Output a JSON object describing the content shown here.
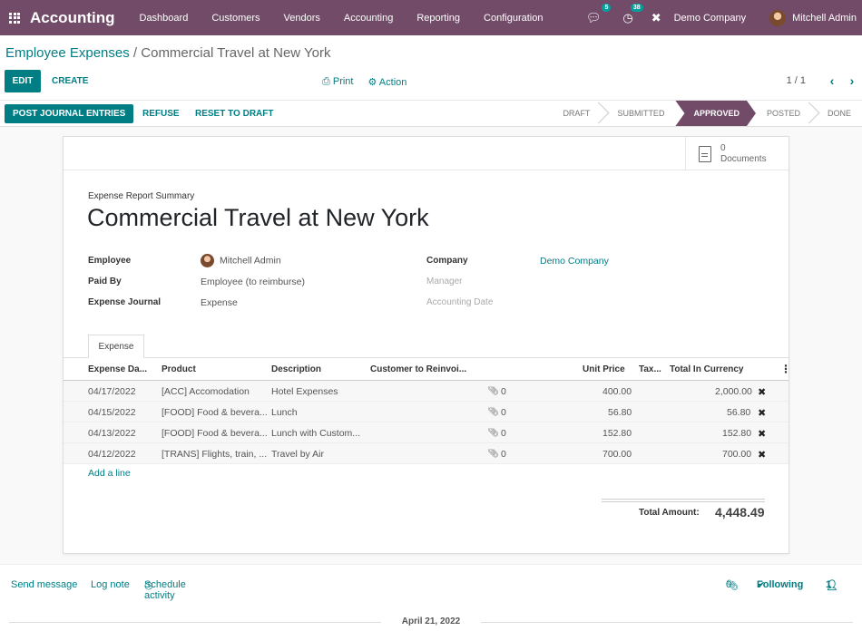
{
  "navbar": {
    "app_title": "Accounting",
    "menu": [
      "Dashboard",
      "Customers",
      "Vendors",
      "Accounting",
      "Reporting",
      "Configuration"
    ],
    "messages_count": "5",
    "activities_count": "38",
    "company": "Demo Company",
    "user": "Mitchell Admin"
  },
  "breadcrumb": {
    "parent": "Employee Expenses",
    "separator": "/",
    "current": "Commercial Travel at New York"
  },
  "controls": {
    "edit": "EDIT",
    "create": "CREATE",
    "print": "Print",
    "action": "Action",
    "pager": "1 / 1"
  },
  "statusbar": {
    "post": "POST JOURNAL ENTRIES",
    "refuse": "REFUSE",
    "reset": "RESET TO DRAFT",
    "stages": [
      "DRAFT",
      "SUBMITTED",
      "APPROVED",
      "POSTED",
      "DONE"
    ],
    "active_stage": "APPROVED"
  },
  "documents": {
    "count": "0",
    "label": "Documents"
  },
  "form": {
    "summary_label": "Expense Report Summary",
    "title": "Commercial Travel at New York",
    "employee_label": "Employee",
    "employee": "Mitchell Admin",
    "paid_by_label": "Paid By",
    "paid_by": "Employee (to reimburse)",
    "journal_label": "Expense Journal",
    "journal": "Expense",
    "company_label": "Company",
    "company": "Demo Company",
    "manager_label": "Manager",
    "accounting_date_label": "Accounting Date"
  },
  "tab": "Expense",
  "table": {
    "headers": [
      "Expense Da...",
      "Product",
      "Description",
      "Customer to Reinvoi...",
      "Unit Price",
      "Tax...",
      "Total In Currency"
    ],
    "rows": [
      {
        "date": "04/17/2022",
        "product": "[ACC] Accomodation",
        "description": "Hotel Expenses",
        "attachments": "0",
        "unit_price": "400.00",
        "total": "2,000.00"
      },
      {
        "date": "04/15/2022",
        "product": "[FOOD] Food & bevera...",
        "description": "Lunch",
        "attachments": "0",
        "unit_price": "56.80",
        "total": "56.80"
      },
      {
        "date": "04/13/2022",
        "product": "[FOOD] Food & bevera...",
        "description": "Lunch with Custom...",
        "attachments": "0",
        "unit_price": "152.80",
        "total": "152.80"
      },
      {
        "date": "04/12/2022",
        "product": "[TRANS] Flights, train, ...",
        "description": "Travel by Air",
        "attachments": "0",
        "unit_price": "700.00",
        "total": "700.00"
      }
    ],
    "add_line": "Add a line",
    "total_label": "Total Amount:",
    "total_value": "4,448.49"
  },
  "chatter": {
    "send_message": "Send message",
    "log_note": "Log note",
    "schedule": "Schedule activity",
    "attachments": "0",
    "following": "Following",
    "followers": "1",
    "date": "April 21, 2022"
  }
}
